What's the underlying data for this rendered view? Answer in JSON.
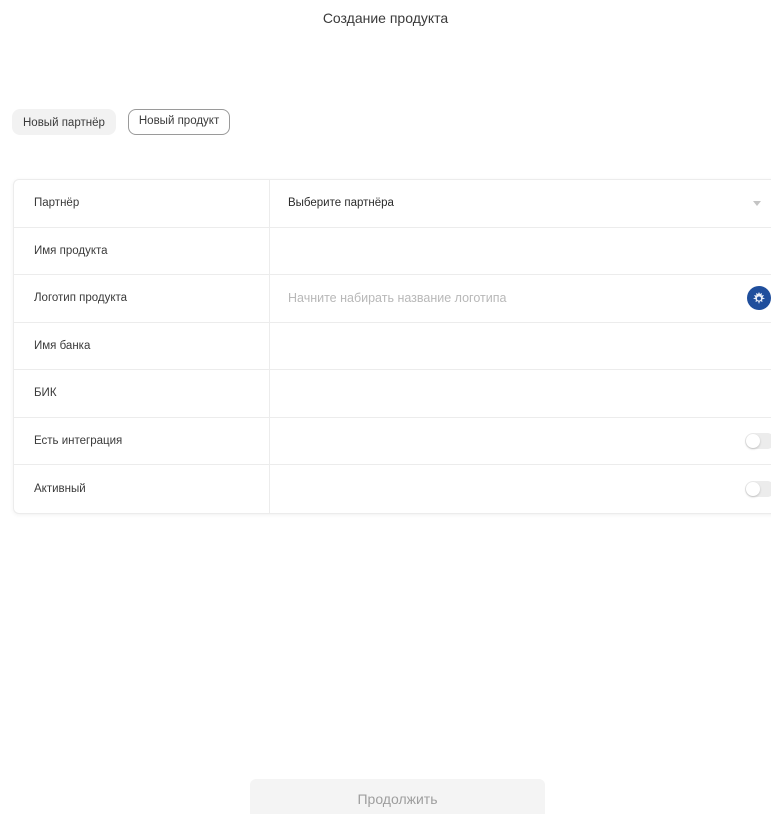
{
  "page": {
    "title": "Создание продукта"
  },
  "tabs": [
    {
      "label": "Новый партнёр",
      "active": false
    },
    {
      "label": "Новый продукт",
      "active": true
    }
  ],
  "form": {
    "partner": {
      "label": "Партнёр",
      "value": "Выберите партнёра"
    },
    "product_name": {
      "label": "Имя продукта",
      "value": ""
    },
    "product_logo": {
      "label": "Логотип продукта",
      "placeholder": "Начните набирать название логотипа"
    },
    "bank_name": {
      "label": "Имя банка",
      "value": ""
    },
    "bik": {
      "label": "БИК",
      "value": ""
    },
    "has_integration": {
      "label": "Есть интеграция",
      "on": false
    },
    "active": {
      "label": "Активный",
      "on": false
    }
  },
  "footer": {
    "continue_label": "Продолжить"
  },
  "colors": {
    "emblem": "#1f4e9c",
    "toggle_off": "#ececec"
  },
  "icons": {
    "dropdown": "chevron-down-icon",
    "logo": "emblem-icon"
  }
}
